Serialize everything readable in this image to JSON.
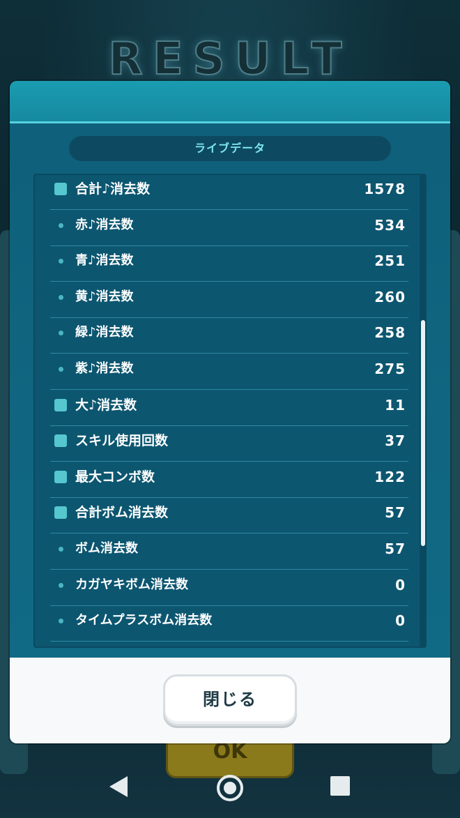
{
  "screen_title": "RESULT",
  "section_title": "ライブデータ",
  "stats": [
    {
      "label": "合計♪消去数",
      "value": "1578",
      "bullet": "square"
    },
    {
      "label": "赤♪消去数",
      "value": "534",
      "bullet": "dot"
    },
    {
      "label": "青♪消去数",
      "value": "251",
      "bullet": "dot"
    },
    {
      "label": "黄♪消去数",
      "value": "260",
      "bullet": "dot"
    },
    {
      "label": "緑♪消去数",
      "value": "258",
      "bullet": "dot"
    },
    {
      "label": "紫♪消去数",
      "value": "275",
      "bullet": "dot"
    },
    {
      "label": "大♪消去数",
      "value": "11",
      "bullet": "square"
    },
    {
      "label": "スキル使用回数",
      "value": "37",
      "bullet": "square"
    },
    {
      "label": "最大コンボ数",
      "value": "122",
      "bullet": "square"
    },
    {
      "label": "合計ボム消去数",
      "value": "57",
      "bullet": "square"
    },
    {
      "label": "ボム消去数",
      "value": "57",
      "bullet": "dot"
    },
    {
      "label": "カガヤキボム消去数",
      "value": "0",
      "bullet": "dot"
    },
    {
      "label": "タイムプラスボム消去数",
      "value": "0",
      "bullet": "dot"
    }
  ],
  "close_label": "閉じる",
  "ok_label": "OK",
  "colors": {
    "header": "#1a9cb0",
    "body": "#0f607a",
    "accent_text": "#7fe7f0",
    "footer": "#f7f9fa"
  },
  "icons": {
    "nav_back": "triangle-back-icon",
    "nav_home": "circle-home-icon",
    "nav_recent": "square-recent-icon"
  }
}
